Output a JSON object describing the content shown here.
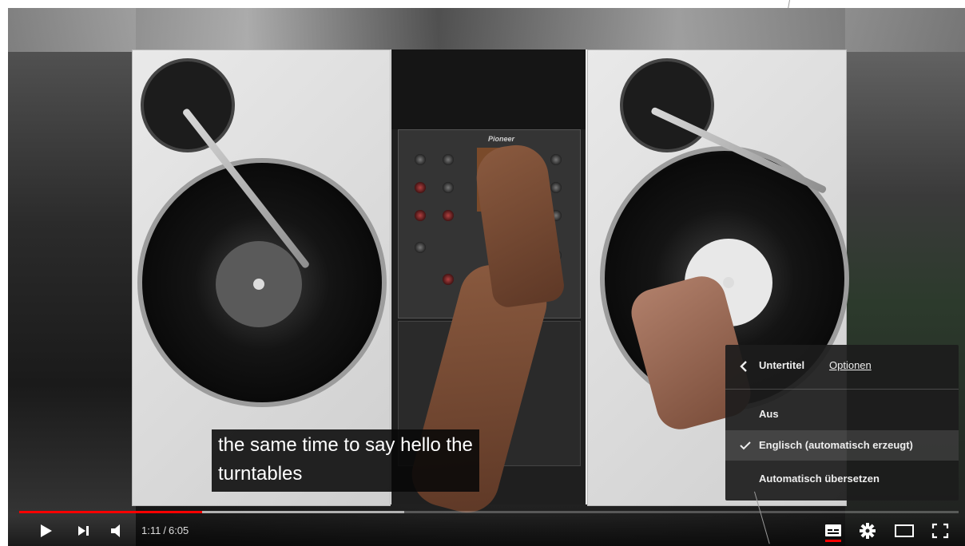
{
  "video": {
    "mixer_brand": "Pioneer"
  },
  "subtitle": {
    "line1": "the same time to say hello the",
    "line2": "turntables"
  },
  "settings_menu": {
    "back_icon": "chevron-left-icon",
    "title": "Untertitel",
    "options_label": "Optionen",
    "items": [
      {
        "label": "Aus",
        "selected": false
      },
      {
        "label": "Englisch (automatisch erzeugt)",
        "selected": true
      },
      {
        "label": "Automatisch übersetzen",
        "selected": false
      }
    ]
  },
  "player": {
    "current_time": "1:11",
    "duration": "6:05",
    "progress_fraction": 0.195,
    "buffered_fraction": 0.41,
    "accent_color": "#ff0000",
    "controls": {
      "play_icon": "play-icon",
      "next_icon": "next-icon",
      "volume_icon": "volume-icon",
      "subtitles_icon": "subtitles-icon",
      "settings_icon": "gear-icon",
      "theater_icon": "theater-mode-icon",
      "fullscreen_icon": "fullscreen-icon"
    }
  }
}
